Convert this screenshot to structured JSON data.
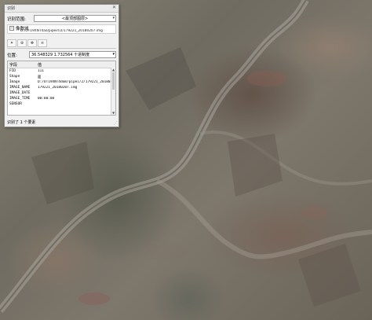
{
  "window": {
    "title": "识别",
    "close_icon": "close-icon"
  },
  "identify_from": {
    "label": "识别范围:",
    "value": "<最顶部图层>"
  },
  "tree": {
    "layer_label": "像数域",
    "item_path": "D:/OT19XNT4ao/pipeirl/2/179221_20180207.img"
  },
  "location": {
    "label": "位置:",
    "value": "36.548329   1.732564  十进制度",
    "units": "十进制度"
  },
  "table": {
    "headers": [
      "字段",
      "值"
    ],
    "rows": [
      {
        "field": "FID",
        "value": "111"
      },
      {
        "field": "Shape",
        "value": "面"
      },
      {
        "field": "Image",
        "value": "D:/OT19XNT4dom/pipei/2/179221_2018020"
      },
      {
        "field": "IMAGE_NAME",
        "value": "179221_20180207.img"
      },
      {
        "field": "IMAGE_DATE",
        "value": ""
      },
      {
        "field": "IMAGE_TIME",
        "value": "00:00:00"
      },
      {
        "field": "SENSOR",
        "value": ""
      }
    ]
  },
  "status": {
    "text": "识别了 1 个要素"
  }
}
